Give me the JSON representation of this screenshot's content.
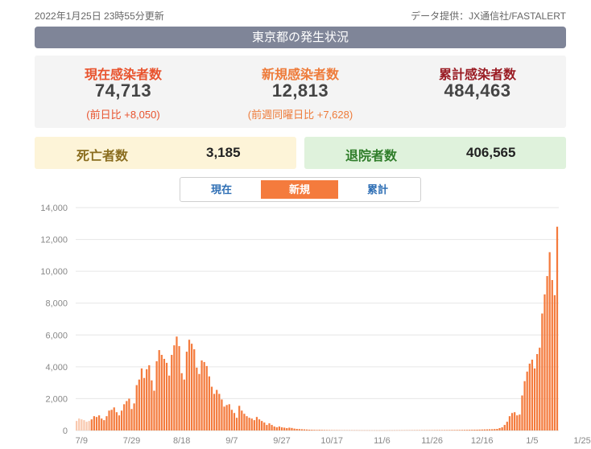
{
  "header": {
    "updated": "2022年1月25日 23時55分更新",
    "source": "データ提供：JX通信社/FASTALERT"
  },
  "banner": {
    "title": "東京都の発生状況"
  },
  "stats": {
    "current": {
      "label": "現在感染者数",
      "value": "74,713",
      "sub": "(前日比 +8,050)"
    },
    "new": {
      "label": "新規感染者数",
      "value": "12,813",
      "sub": "(前週同曜日比 +7,628)"
    },
    "total": {
      "label": "累計感染者数",
      "value": "484,463"
    }
  },
  "deaths": {
    "label": "死亡者数",
    "value": "3,185"
  },
  "discharged": {
    "label": "退院者数",
    "value": "406,565"
  },
  "tabs": [
    {
      "label": "現在",
      "active": false
    },
    {
      "label": "新規",
      "active": true
    },
    {
      "label": "累計",
      "active": false
    }
  ],
  "colors": {
    "bar": "#f47b3d",
    "bar_faded": "#f9c8ae",
    "grid": "#e6e6e6",
    "tab_active": "#f47b3d",
    "link": "#2f6fb5"
  },
  "chart_data": {
    "type": "bar",
    "ylim": [
      0,
      14000
    ],
    "yticks": [
      "0",
      "2,000",
      "4,000",
      "6,000",
      "8,000",
      "10,000",
      "12,000",
      "14,000"
    ],
    "ytick_values": [
      0,
      2000,
      4000,
      6000,
      8000,
      10000,
      12000,
      14000
    ],
    "xticks": [
      "7/9",
      "7/29",
      "8/18",
      "9/7",
      "9/27",
      "10/17",
      "11/6",
      "11/26",
      "12/16",
      "1/5",
      "1/25"
    ],
    "xtick_index": [
      2,
      22,
      42,
      62,
      82,
      102,
      122,
      142,
      162,
      182,
      202
    ],
    "faded_count": 6,
    "values": [
      600,
      750,
      700,
      650,
      550,
      600,
      700,
      900,
      850,
      950,
      750,
      650,
      900,
      1250,
      1300,
      1450,
      1150,
      950,
      1250,
      1650,
      1850,
      2000,
      1350,
      1700,
      2850,
      3200,
      3900,
      3300,
      3850,
      4100,
      3150,
      2500,
      4350,
      5050,
      4750,
      4500,
      4250,
      3450,
      4750,
      5350,
      5900,
      5300,
      3600,
      3200,
      4950,
      5700,
      5450,
      5100,
      3950,
      3550,
      4400,
      4300,
      4050,
      3400,
      2750,
      2300,
      2550,
      2300,
      1950,
      1500,
      1600,
      1650,
      1300,
      1100,
      800,
      1550,
      1250,
      1050,
      900,
      800,
      750,
      650,
      850,
      700,
      600,
      500,
      350,
      450,
      350,
      250,
      200,
      250,
      200,
      180,
      150,
      180,
      160,
      120,
      100,
      90,
      80,
      70,
      60,
      50,
      45,
      40,
      35,
      40,
      35,
      30,
      28,
      25,
      22,
      20,
      20,
      18,
      15,
      16,
      15,
      14,
      13,
      12,
      12,
      11,
      10,
      10,
      10,
      9,
      9,
      9,
      8,
      8,
      8,
      8,
      9,
      10,
      10,
      11,
      12,
      12,
      13,
      14,
      15,
      15,
      16,
      17,
      18,
      18,
      19,
      20,
      21,
      22,
      22,
      23,
      24,
      25,
      25,
      26,
      27,
      28,
      30,
      30,
      32,
      33,
      35,
      38,
      40,
      42,
      45,
      48,
      50,
      55,
      60,
      65,
      70,
      75,
      80,
      90,
      100,
      150,
      200,
      350,
      550,
      900,
      1100,
      1150,
      950,
      1000,
      2200,
      3100,
      3700,
      4200,
      4450,
      3900,
      4800,
      5200,
      7350,
      8550,
      9700,
      11200,
      9450,
      8500,
      12800
    ]
  }
}
